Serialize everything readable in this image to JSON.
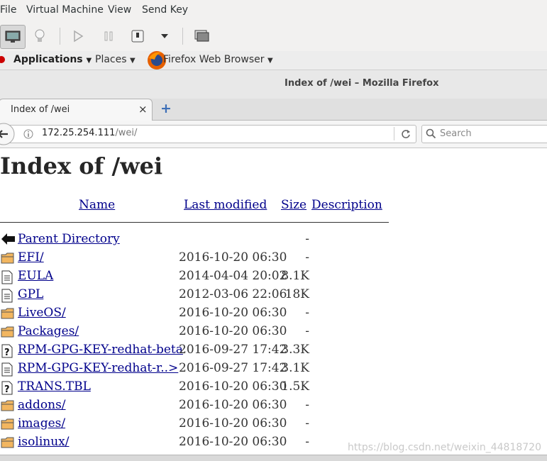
{
  "vm_menu": [
    "File",
    "Virtual Machine",
    "View",
    "Send Key"
  ],
  "gnome": {
    "applications": "Applications",
    "places": "Places",
    "app_name": "Firefox Web Browser"
  },
  "window_title": "Index of /wei – Mozilla Firefox",
  "tab": {
    "title": "Index of /wei",
    "close": "×",
    "new_tab": "+"
  },
  "nav": {
    "url_host": "172.25.254.111",
    "url_path": "/wei/",
    "search_placeholder": "Search"
  },
  "page": {
    "heading": "Index of /wei",
    "columns": {
      "name": "Name",
      "modified": "Last modified",
      "size": "Size",
      "description": "Description"
    },
    "rows": [
      {
        "icon": "back-icon",
        "name": "Parent Directory",
        "modified": "",
        "size": "-"
      },
      {
        "icon": "folder-icon",
        "name": "EFI/",
        "modified": "2016-10-20 06:30",
        "size": "-"
      },
      {
        "icon": "text-file-icon",
        "name": "EULA",
        "modified": "2014-04-04 20:02",
        "size": "8.1K"
      },
      {
        "icon": "text-file-icon",
        "name": "GPL",
        "modified": "2012-03-06 22:06",
        "size": "18K"
      },
      {
        "icon": "folder-icon",
        "name": "LiveOS/",
        "modified": "2016-10-20 06:30",
        "size": "-"
      },
      {
        "icon": "folder-icon",
        "name": "Packages/",
        "modified": "2016-10-20 06:30",
        "size": "-"
      },
      {
        "icon": "unknown-file-icon",
        "name": "RPM-GPG-KEY-redhat-beta",
        "modified": "2016-09-27 17:42",
        "size": "3.3K"
      },
      {
        "icon": "text-file-icon",
        "name": "RPM-GPG-KEY-redhat-r..>",
        "modified": "2016-09-27 17:42",
        "size": "3.1K"
      },
      {
        "icon": "unknown-file-icon",
        "name": "TRANS.TBL",
        "modified": "2016-10-20 06:30",
        "size": "1.5K"
      },
      {
        "icon": "folder-icon",
        "name": "addons/",
        "modified": "2016-10-20 06:30",
        "size": "-"
      },
      {
        "icon": "folder-icon",
        "name": "images/",
        "modified": "2016-10-20 06:30",
        "size": "-"
      },
      {
        "icon": "folder-icon",
        "name": "isolinux/",
        "modified": "2016-10-20 06:30",
        "size": "-"
      }
    ]
  },
  "watermark": "https://blog.csdn.net/weixin_44818720"
}
